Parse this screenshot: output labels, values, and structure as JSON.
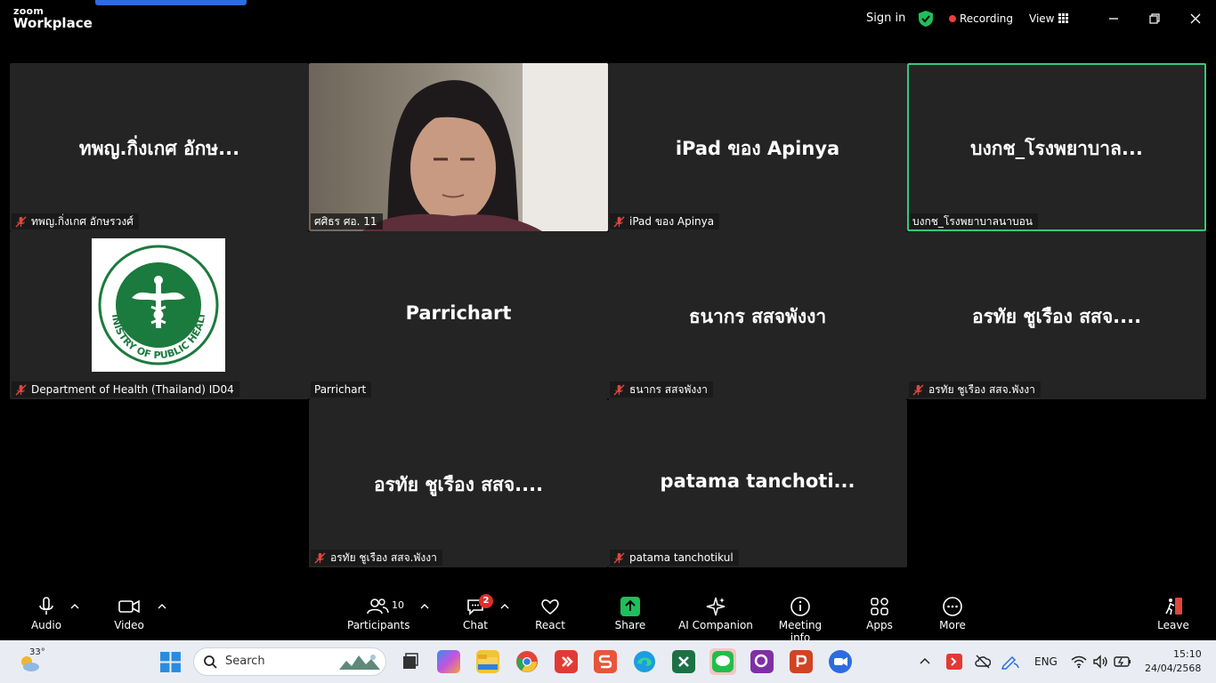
{
  "app": {
    "brand_top": "zoom",
    "brand_bottom": "Workplace"
  },
  "titlebar": {
    "sign_in": "Sign in",
    "recording": "Recording",
    "view": "View"
  },
  "tiles": [
    {
      "big": "ทพญ.กิ่งเกศ อักษ...",
      "tag": "ทพญ.กิ่งเกศ อักษรวงศ์",
      "muted": true
    },
    {
      "big": "",
      "tag": "ศศิธร ศอ. 11",
      "muted": false,
      "video": true
    },
    {
      "big": "iPad ของ Apinya",
      "tag": "iPad ของ Apinya",
      "muted": true
    },
    {
      "big": "บงกช_โรงพยาบาล...",
      "tag": "บงกช_โรงพยาบาลนาบอน",
      "muted": false,
      "speaking": true
    },
    {
      "big": "",
      "tag": "Department of Health (Thailand) ID04",
      "muted": true,
      "logo": true
    },
    {
      "big": "Parrichart",
      "tag": "Parrichart",
      "muted": false
    },
    {
      "big": "ธนากร สสจพังงา",
      "tag": "ธนากร สสจพังงา",
      "muted": true
    },
    {
      "big": "อรทัย ชูเรือง สสจ....",
      "tag": "อรทัย ชูเรือง สสจ.พังงา",
      "muted": true
    },
    {
      "big": "อรทัย ชูเรือง สสจ....",
      "tag": "อรทัย ชูเรือง สสจ.พังงา",
      "muted": true
    },
    {
      "big": "patama tanchoti...",
      "tag": "patama tanchotikul",
      "muted": true
    }
  ],
  "toolbar": {
    "audio": "Audio",
    "video": "Video",
    "participants": "Participants",
    "participants_count": "10",
    "chat": "Chat",
    "chat_badge": "2",
    "react": "React",
    "share": "Share",
    "ai_companion": "AI Companion",
    "meeting_info": "Meeting info",
    "apps": "Apps",
    "more": "More",
    "leave": "Leave"
  },
  "taskbar": {
    "temperature": "33°",
    "search_placeholder": "Search",
    "language": "ENG",
    "time": "15:10",
    "date": "24/04/2568"
  },
  "colors": {
    "accent": "#2d6cdf",
    "speaking_border": "#35c97a",
    "recording": "#e8413a",
    "share_green": "#1fbf5a",
    "mute_red": "#e0463e"
  }
}
